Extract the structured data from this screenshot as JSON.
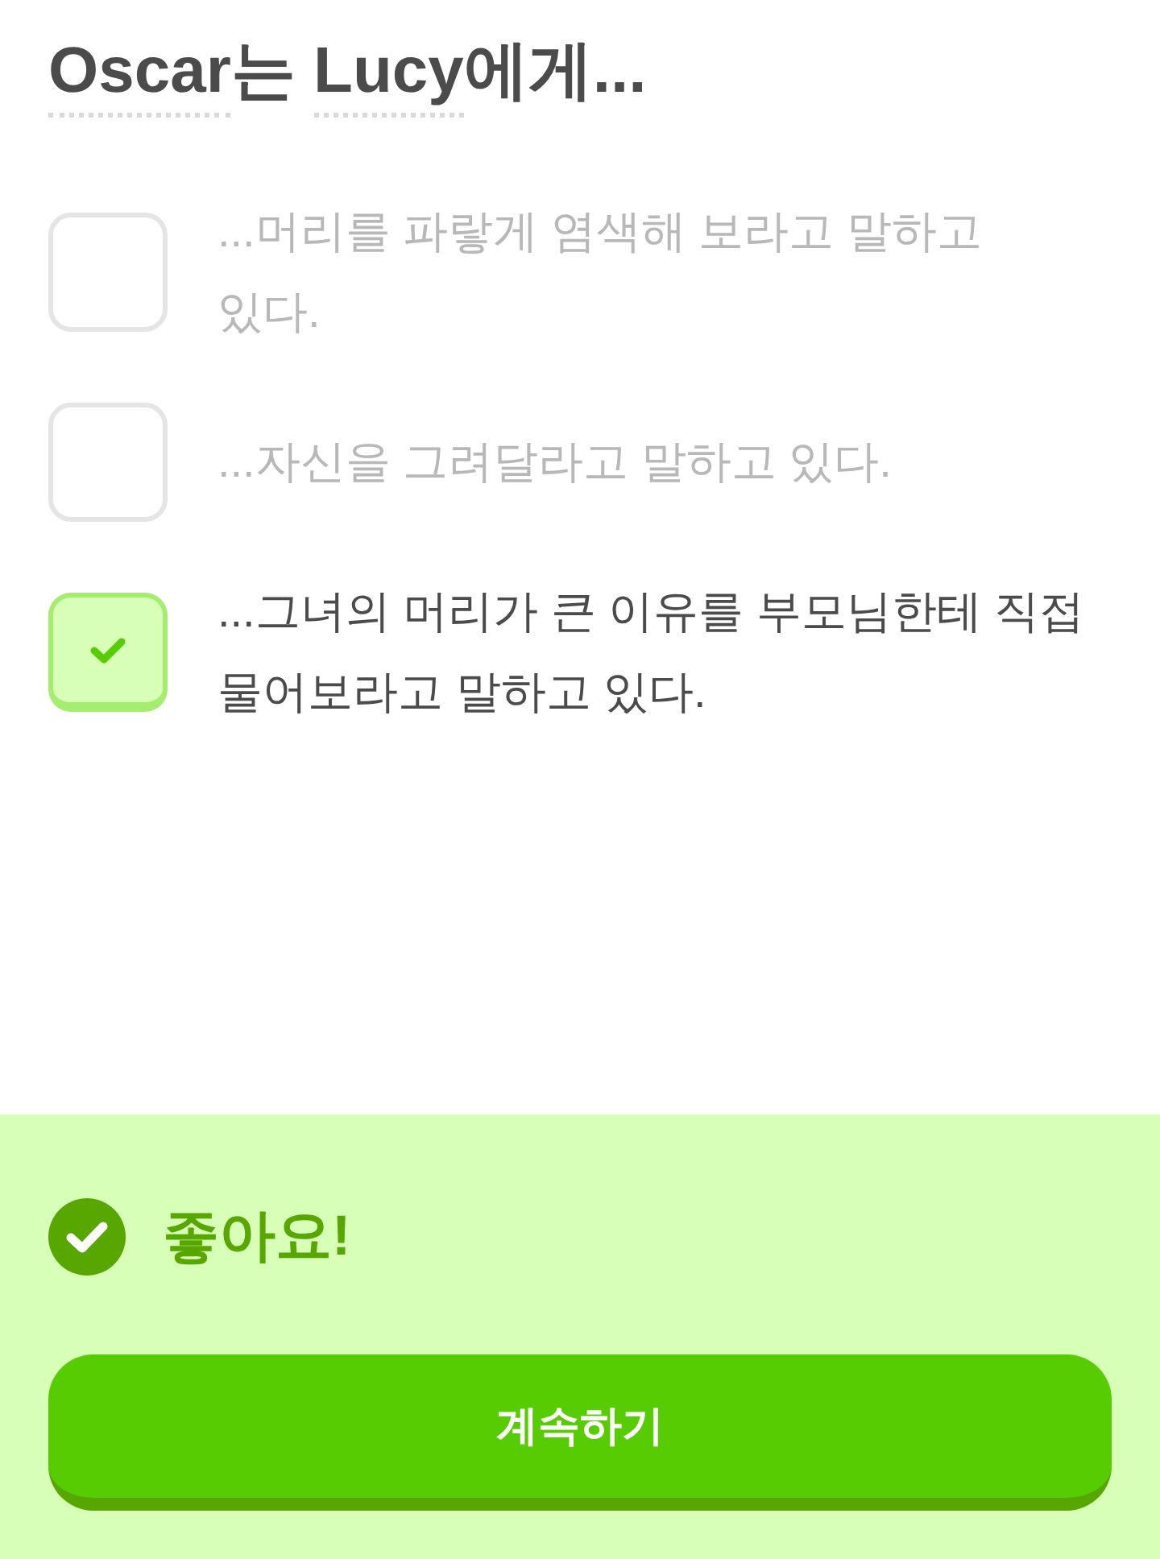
{
  "question": {
    "segments": [
      {
        "text": "Oscar",
        "hint": true
      },
      {
        "text": "는 ",
        "hint": false
      },
      {
        "text": "Lucy",
        "hint": true
      },
      {
        "text": "에게...",
        "hint": false
      }
    ]
  },
  "options": [
    {
      "text": "...머리를 파랗게 염색해 보라고 말하고 있다.",
      "selected": false
    },
    {
      "text": "...자신을 그려달라고 말하고 있다.",
      "selected": false
    },
    {
      "text": "...그녀의 머리가 큰 이유를 부모님한테 직접 물어보라고 말하고 있다.",
      "selected": true
    }
  ],
  "feedback": {
    "kind": "correct",
    "message": "좋아요!",
    "button": "계속하기"
  }
}
